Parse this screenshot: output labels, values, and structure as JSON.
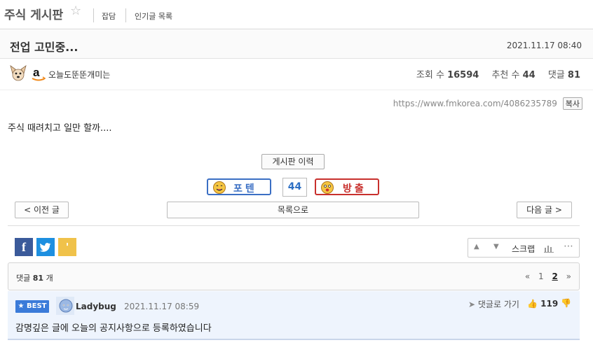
{
  "board": {
    "title": "주식 게시판",
    "links": [
      "잡담",
      "인기글 목록"
    ]
  },
  "post": {
    "title": "전업 고민중...",
    "date": "2021.11.17 08:40",
    "author": "오늘도뚠뚠개미는",
    "stats": {
      "views_label": "조회 수",
      "views": "16594",
      "recommend_label": "추천 수",
      "recommend": "44",
      "comments_label": "댓글",
      "comments": "81"
    },
    "url": "https://www.fmkorea.com/4086235789",
    "copy_label": "복사",
    "body": "주식 때려치고 일만 할까...."
  },
  "actions": {
    "history": "게시판 이력",
    "vote_up": "포텐",
    "vote_count": "44",
    "vote_down": "방출",
    "prev": "< 이전 글",
    "list": "목록으로",
    "next": "다음 글 >",
    "scrap": "스크랩"
  },
  "share": {
    "facebook": "f",
    "twitter": "",
    "kakaostory": "'"
  },
  "comments_header": {
    "prefix": "댓글",
    "count": "81",
    "suffix": "개",
    "pager": {
      "prev": "«",
      "pages": [
        "1",
        "2"
      ],
      "current": "2",
      "next": "»"
    }
  },
  "best_comment": {
    "badge": "BEST",
    "author": "Ladybug",
    "date": "2021.11.17 08:59",
    "goto": "댓글로 가기",
    "likes": "119",
    "text": "감명깊은 글에 오늘의 공지사항으로 등록하였습니다"
  },
  "colors": {
    "accent_blue": "#3b6fc4",
    "accent_red": "#c8302d",
    "best_badge": "#3b7bd9",
    "best_bg": "#eef4fd"
  }
}
